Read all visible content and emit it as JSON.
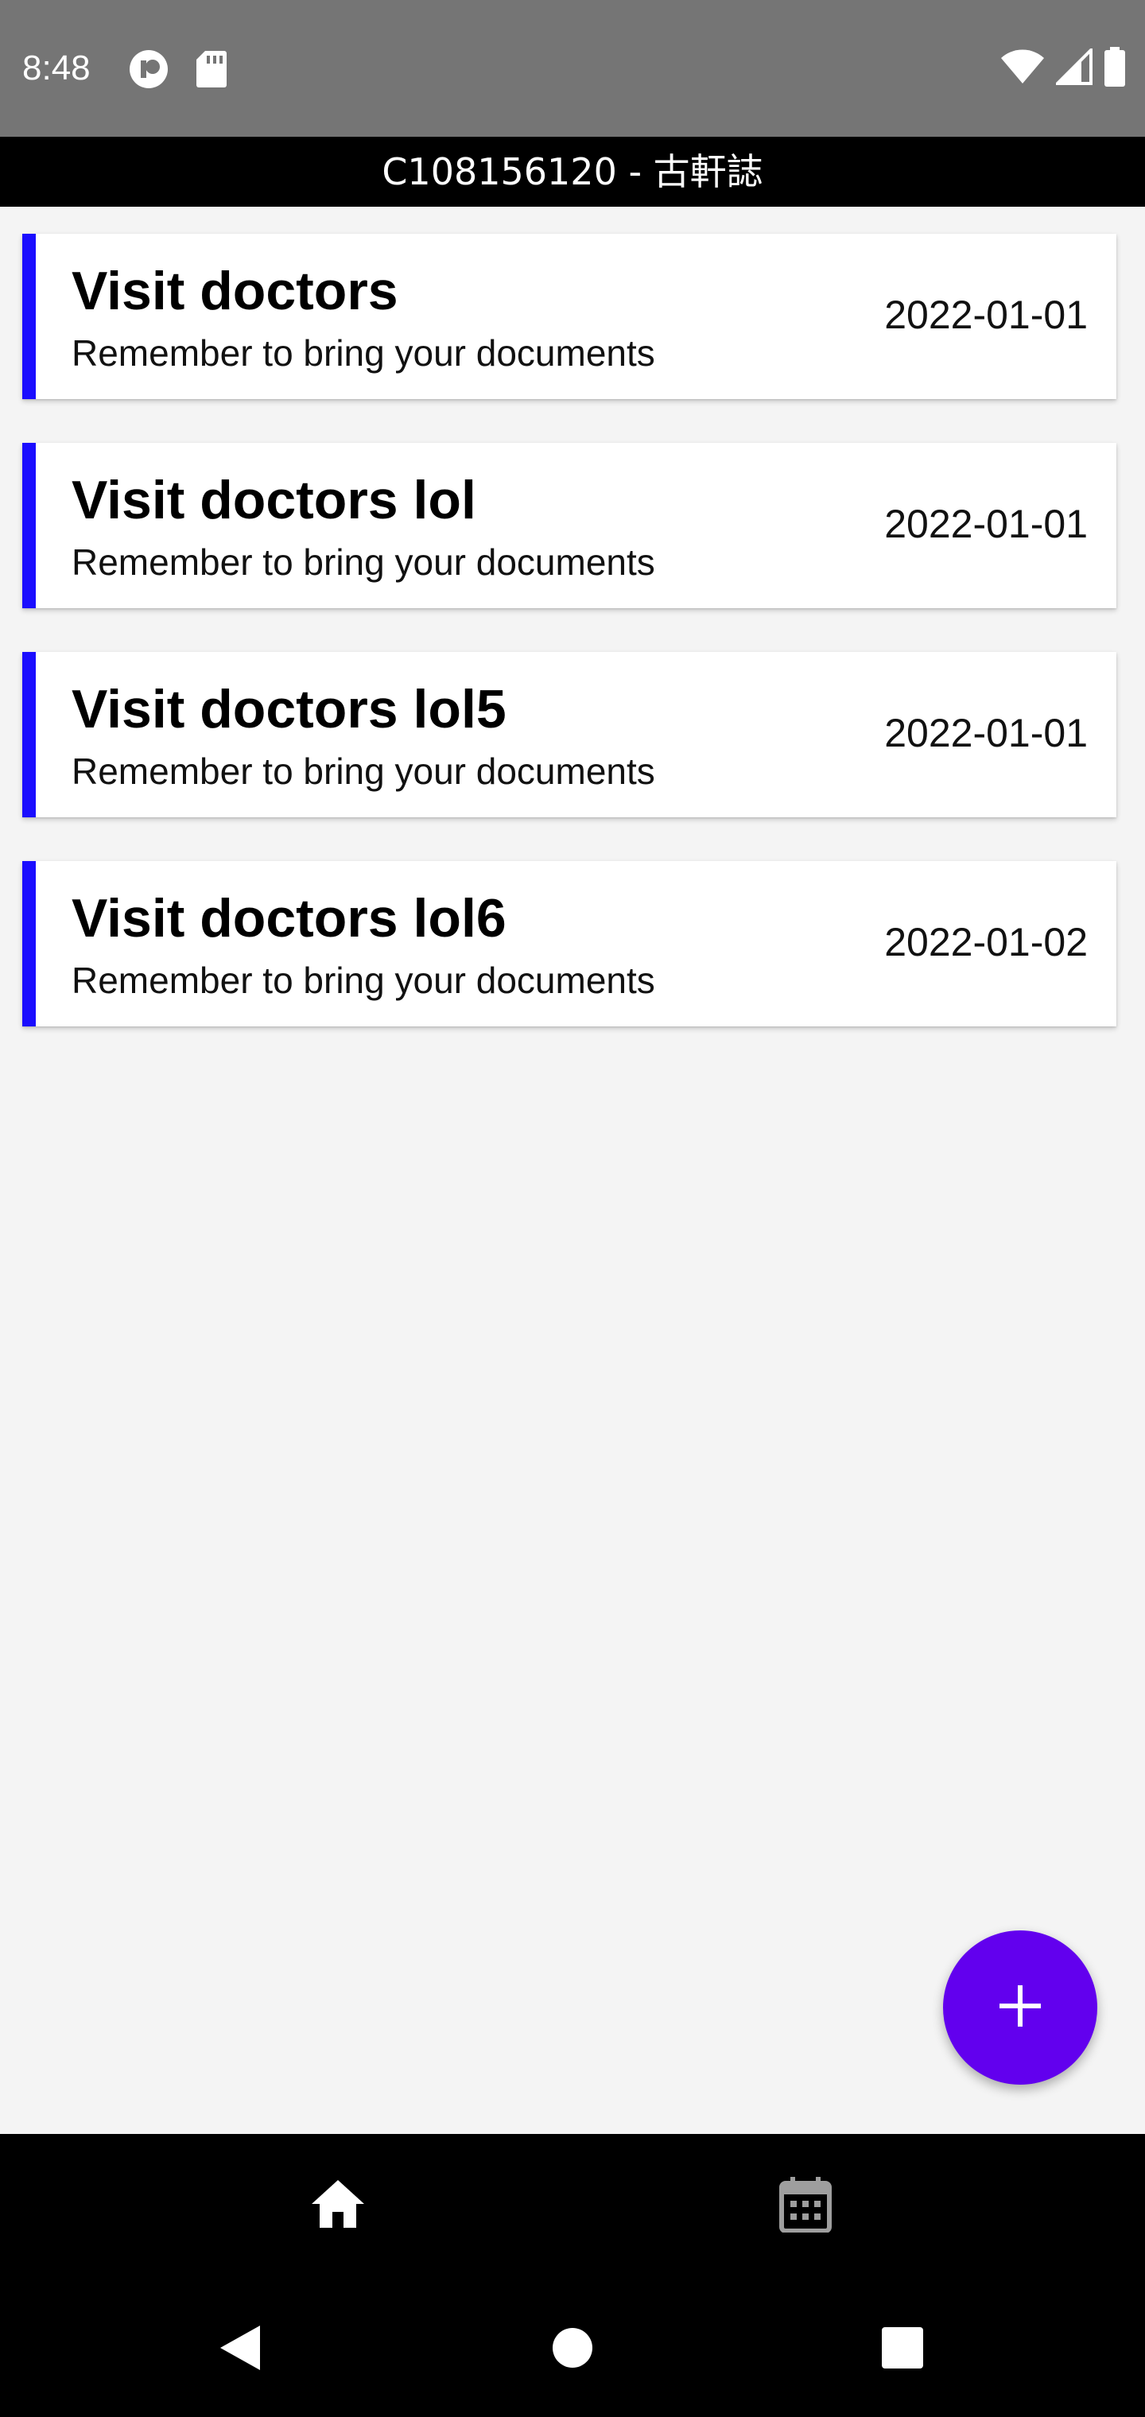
{
  "status_bar": {
    "time": "8:48",
    "left_icons": [
      "privacy-indicator-icon",
      "sd-card-icon"
    ],
    "right_icons": [
      "wifi-icon",
      "cellular-signal-icon",
      "battery-icon"
    ]
  },
  "app": {
    "title": "C108156120 - 古軒誌"
  },
  "tasks": [
    {
      "title": "Visit doctors",
      "description": "Remember to bring your documents",
      "date": "2022-01-01"
    },
    {
      "title": "Visit doctors lol",
      "description": "Remember to bring your documents",
      "date": "2022-01-01"
    },
    {
      "title": "Visit doctors lol5",
      "description": "Remember to bring your documents",
      "date": "2022-01-01"
    },
    {
      "title": "Visit doctors lol6",
      "description": "Remember to bring your documents",
      "date": "2022-01-02"
    }
  ],
  "fab": {
    "icon": "plus-icon"
  },
  "bottom_nav": {
    "items": [
      {
        "icon": "home-icon",
        "active": true
      },
      {
        "icon": "calendar-icon",
        "active": false
      }
    ]
  },
  "system_nav": {
    "buttons": [
      "back-icon",
      "home-circle-icon",
      "recents-icon"
    ]
  },
  "colors": {
    "status_bar": "#757575",
    "card_accent": "#1a0dff",
    "fab": "#6200ee",
    "background": "#f4f4f4",
    "nav_active": "#ffffff",
    "nav_inactive": "#9e9e9e"
  }
}
